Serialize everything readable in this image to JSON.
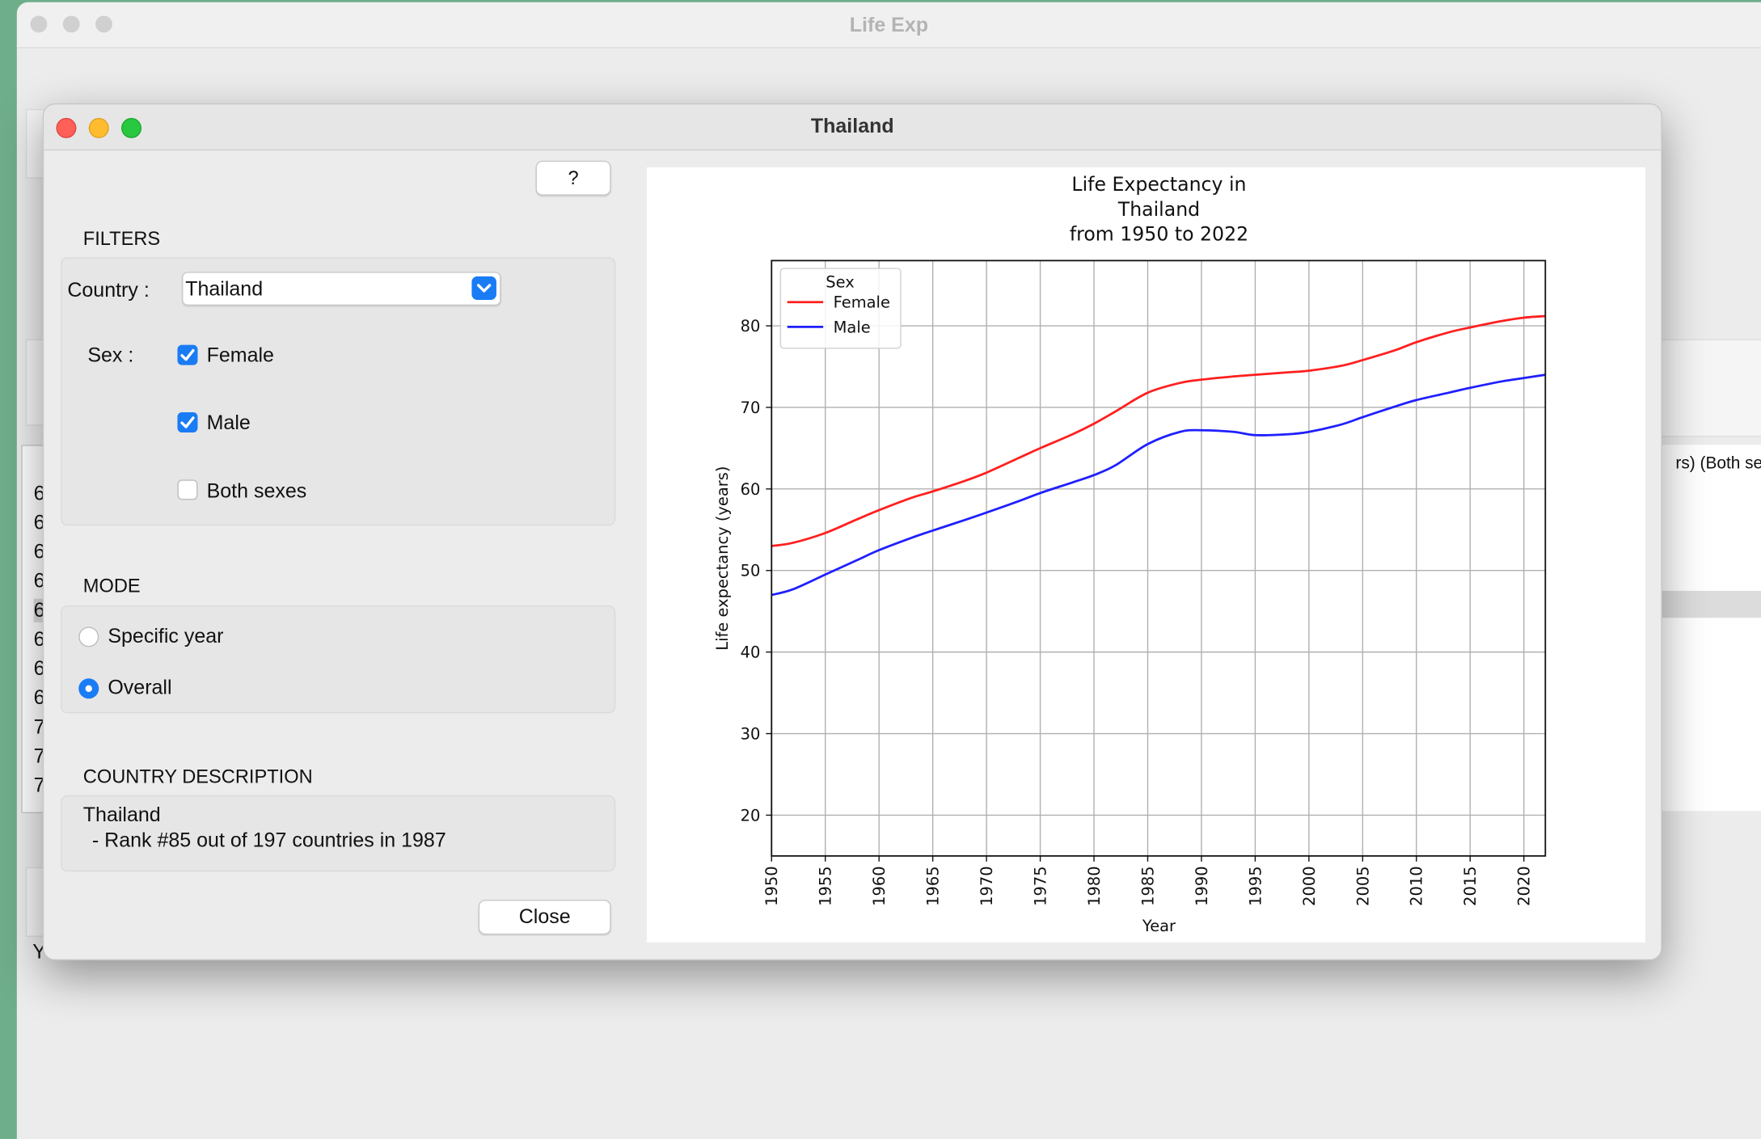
{
  "background_window": {
    "title": "Life Exp",
    "list_rows": [
      "6",
      "6",
      "6",
      "6",
      "6",
      "6",
      "6",
      "6",
      "7",
      "7",
      "7"
    ],
    "table_header_fragment": "rs) (Both se",
    "status_fragment": "Y"
  },
  "dialog": {
    "title": "Thailand",
    "help_label": "?",
    "close_label": "Close"
  },
  "filters": {
    "heading": "FILTERS",
    "country_label": "Country :",
    "country_value": "Thailand",
    "sex_label": "Sex :",
    "options": [
      {
        "label": "Female",
        "checked": true
      },
      {
        "label": "Male",
        "checked": true
      },
      {
        "label": "Both sexes",
        "checked": false
      }
    ]
  },
  "mode": {
    "heading": "MODE",
    "options": [
      {
        "label": "Specific year",
        "selected": false
      },
      {
        "label": "Overall",
        "selected": true
      }
    ]
  },
  "country_description": {
    "heading": "COUNTRY DESCRIPTION",
    "line1": "Thailand",
    "line2": " - Rank #85 out of 197 countries in 1987"
  },
  "chart_data": {
    "type": "line",
    "title": "Life Expectancy in\nThailand\nfrom 1950 to 2022",
    "xlabel": "Year",
    "ylabel": "Life expectancy (years)",
    "xlim": [
      1950,
      2022
    ],
    "ylim": [
      15,
      88
    ],
    "xticks": [
      1950,
      1955,
      1960,
      1965,
      1970,
      1975,
      1980,
      1985,
      1990,
      1995,
      2000,
      2005,
      2010,
      2015,
      2020
    ],
    "yticks": [
      20,
      30,
      40,
      50,
      60,
      70,
      80
    ],
    "grid": true,
    "legend": {
      "title": "Sex",
      "placement": "top-left"
    },
    "x": [
      1950,
      1952,
      1955,
      1958,
      1960,
      1963,
      1965,
      1968,
      1970,
      1973,
      1975,
      1978,
      1980,
      1982,
      1985,
      1988,
      1990,
      1993,
      1995,
      1998,
      2000,
      2003,
      2005,
      2008,
      2010,
      2013,
      2015,
      2018,
      2020,
      2022
    ],
    "series": [
      {
        "name": "Female",
        "color": "#ff1f1f",
        "values": [
          53.0,
          53.4,
          54.6,
          56.3,
          57.4,
          58.9,
          59.7,
          61.0,
          62.0,
          63.8,
          65.0,
          66.7,
          68.0,
          69.5,
          71.8,
          73.0,
          73.4,
          73.8,
          74.0,
          74.3,
          74.5,
          75.1,
          75.8,
          77.0,
          78.0,
          79.2,
          79.8,
          80.6,
          81.0,
          81.2
        ]
      },
      {
        "name": "Male",
        "color": "#1f1fff",
        "values": [
          47.0,
          47.7,
          49.5,
          51.3,
          52.5,
          54.0,
          54.9,
          56.2,
          57.1,
          58.5,
          59.5,
          60.8,
          61.7,
          62.9,
          65.5,
          67.0,
          67.2,
          67.0,
          66.6,
          66.7,
          67.0,
          67.9,
          68.8,
          70.1,
          70.9,
          71.8,
          72.4,
          73.2,
          73.6,
          74.0
        ]
      }
    ]
  }
}
